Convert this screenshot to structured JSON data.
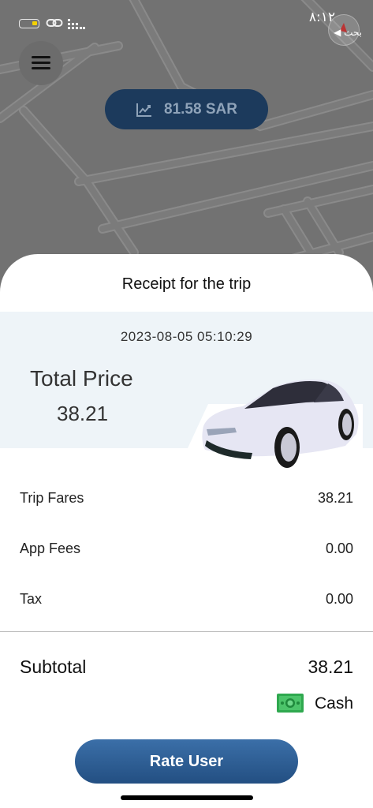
{
  "status_bar": {
    "time": "٨:١٢",
    "back_app": "◀ بحث",
    "battery_icon": "battery-low-icon",
    "link_icon": "link-icon",
    "signal_icon": "signal-icon"
  },
  "map": {
    "menu_icon": "hamburger-menu-icon",
    "earnings_icon": "trend-chart-icon",
    "earnings_value": "81.58 SAR"
  },
  "receipt": {
    "title": "Receipt for the trip",
    "datetime": "2023-08-05 05:10:29",
    "total_label": "Total Price",
    "total_value": "38.21",
    "rows": [
      {
        "label": "Trip Fares",
        "value": "38.21"
      },
      {
        "label": "App Fees",
        "value": "0.00"
      },
      {
        "label": "Tax",
        "value": "0.00"
      }
    ],
    "subtotal_label": "Subtotal",
    "subtotal_value": "38.21",
    "payment_icon": "cash-money-icon",
    "payment_label": "Cash",
    "rate_button": "Rate User"
  },
  "colors": {
    "accent": "#2a5a90",
    "earnings_pill": "#1c3a5c",
    "hero_bg": "#eef4f8"
  }
}
